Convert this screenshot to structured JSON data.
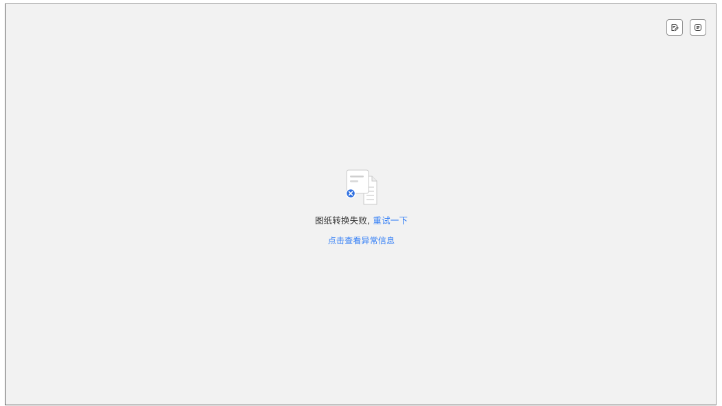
{
  "viewer": {
    "toolbar": {
      "edit_icon": "edit-document-icon",
      "info_icon": "info-panel-icon"
    },
    "empty_state": {
      "illustration_icon": "document-conversion-failed-icon",
      "message": "图纸转换失败,",
      "retry_label": "重试一下",
      "detail_link_label": "点击查看异常信息"
    },
    "colors": {
      "accent": "#2f7cf6",
      "background": "#f2f2f2",
      "text": "#333333",
      "error_badge": "#2f6fe0"
    }
  }
}
